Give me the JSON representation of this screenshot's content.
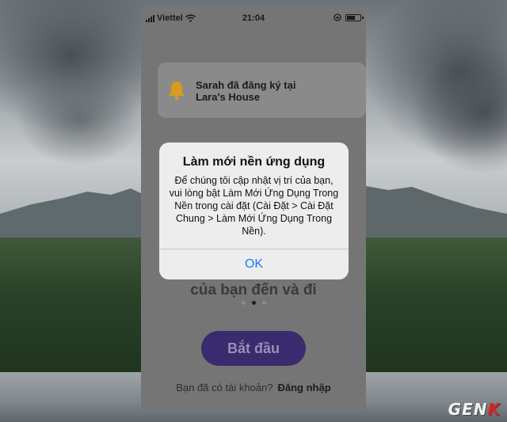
{
  "status_bar": {
    "carrier": "Viettel",
    "time": "21:04"
  },
  "notification": {
    "line1": "Sarah đã đăng ký tại",
    "line2": "Lara's House",
    "icon": "bell-icon",
    "icon_color": "#d99a1e"
  },
  "onboarding": {
    "caption": "của bạn đến và đi",
    "page_total": 3,
    "page_active": 2,
    "start_label": "Bắt đầu",
    "login_prompt": "Bạn đã có tài khoản?",
    "login_link": "Đăng nhập"
  },
  "alert": {
    "title": "Làm mới nền ứng dụng",
    "message": "Để chúng tôi cập nhật vị trí của bạn, vui lòng bật Làm Mới Ứng Dụng Trong Nền trong cài đặt (Cài Đặt > Cài Đặt Chung > Làm Mới Ứng Dụng Trong Nền).",
    "ok_label": "OK",
    "ok_color": "#1a7cf5"
  },
  "watermark": {
    "left": "GEN",
    "right": "K"
  }
}
